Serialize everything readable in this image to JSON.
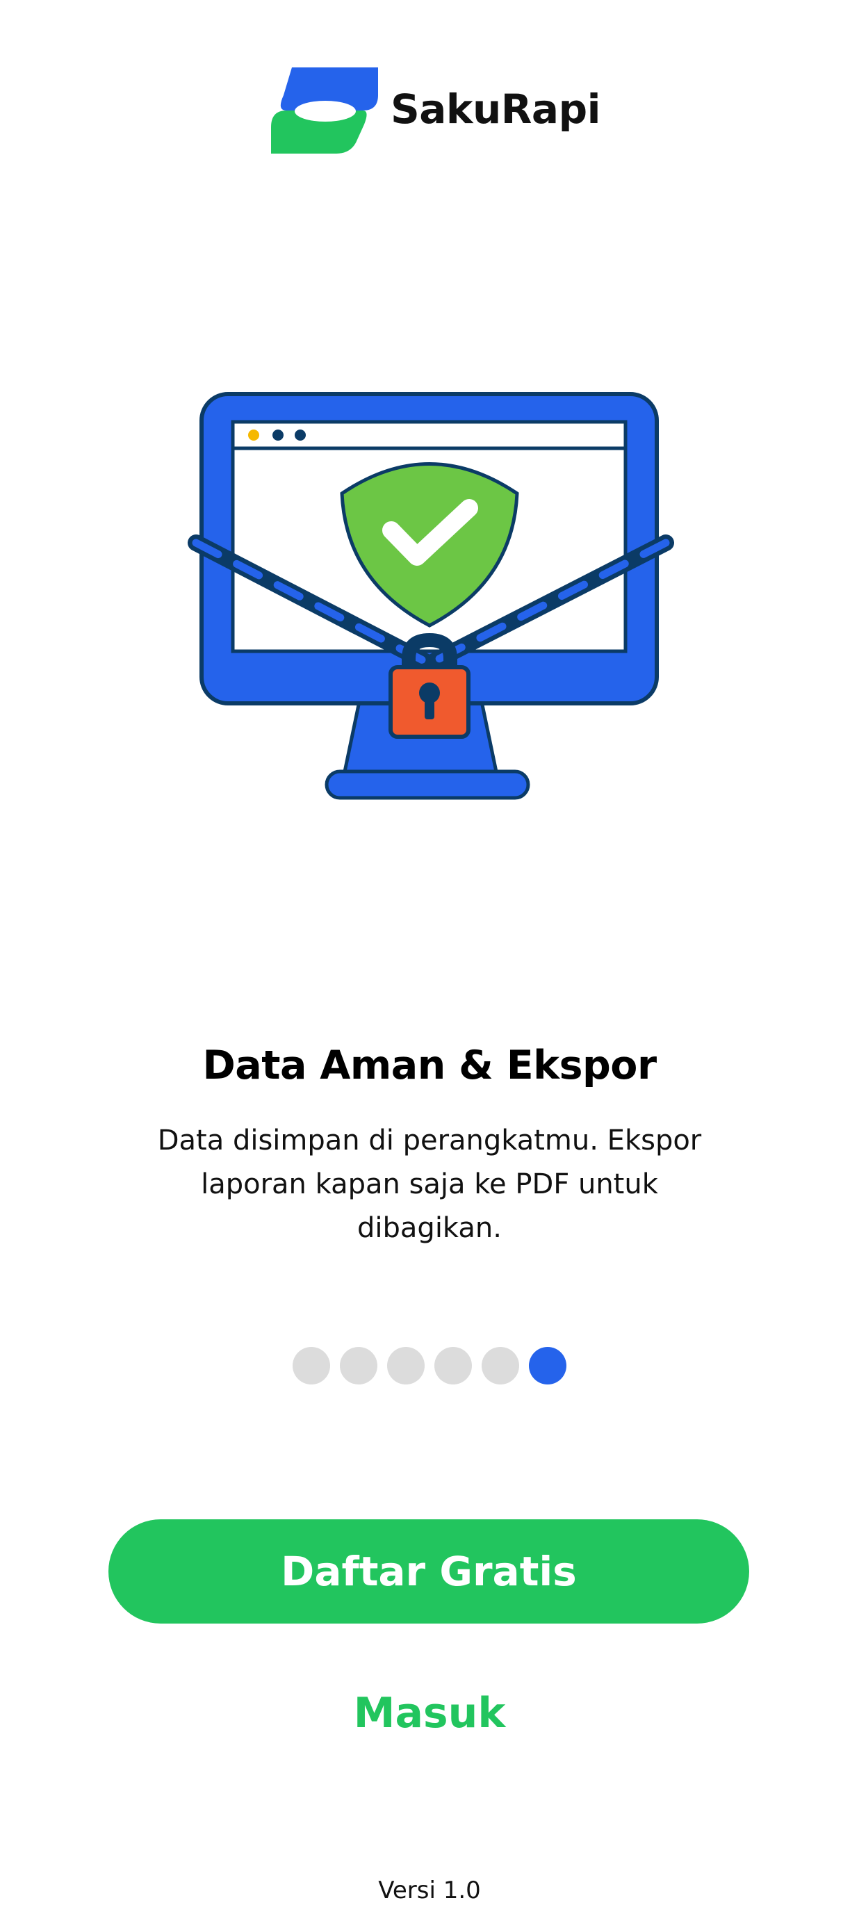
{
  "app": {
    "name": "SakuRapi"
  },
  "slide": {
    "title": "Data Aman & Ekspor",
    "description": "Data disimpan di perangkatmu. Ekspor laporan kapan saja ke PDF untuk dibagikan."
  },
  "pager": {
    "total": 6,
    "active_index": 5
  },
  "actions": {
    "primary_label": "Daftar Gratis",
    "secondary_label": "Masuk"
  },
  "footer": {
    "version": "Versi 1.0"
  },
  "illustration": {
    "icons": [
      "monitor-icon",
      "shield-check-icon",
      "chain-icon",
      "padlock-icon"
    ]
  },
  "colors": {
    "primary_green": "#22c55e",
    "brand_blue": "#2563eb",
    "dot_inactive": "#dcdcdc",
    "lock_orange": "#f05a2e"
  }
}
